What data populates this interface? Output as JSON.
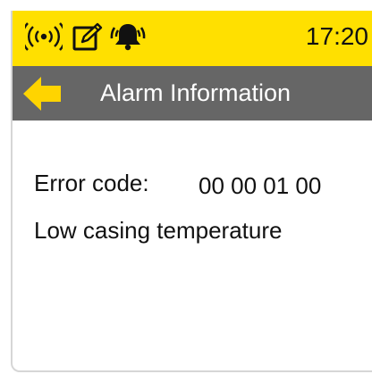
{
  "colors": {
    "status_bar": "#ffe000",
    "title_bar": "#666666",
    "back_arrow": "#ffd400",
    "text": "#111111"
  },
  "status_bar": {
    "icons": [
      "wireless-signal-icon",
      "edit-note-icon",
      "alarm-bell-icon"
    ],
    "time": "17:20"
  },
  "header": {
    "back_icon": "back-arrow-icon",
    "title": "Alarm Information"
  },
  "alarm": {
    "error_code_label": "Error code:",
    "error_code_value": "00 00 01 00",
    "description": "Low casing temperature"
  }
}
